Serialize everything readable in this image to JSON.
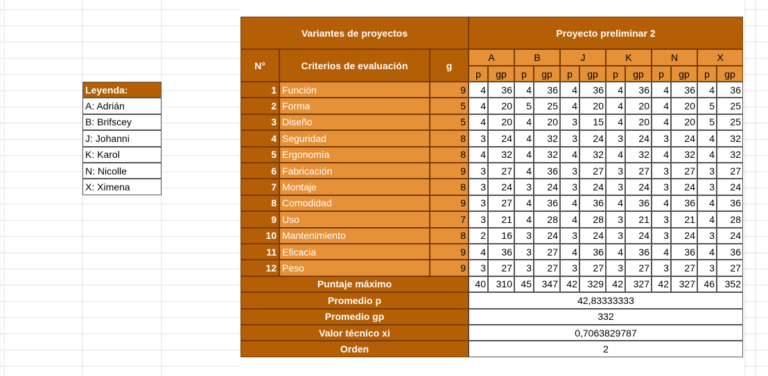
{
  "legend": {
    "title": "Leyenda:",
    "items": [
      "A: Adrián",
      "B: Brifscey",
      "J: Johanni",
      "K: Karol",
      "N: Nicolle",
      "X: Ximena"
    ]
  },
  "table": {
    "title_left": "Variantes de proyectos",
    "title_right": "Proyecto preliminar 2",
    "col_no": "N°",
    "col_criteria": "Criterios de evaluación",
    "col_g": "g",
    "groups": [
      "A",
      "B",
      "J",
      "K",
      "N",
      "X"
    ],
    "sub_p": "p",
    "sub_gp": "gp",
    "rows": [
      {
        "n": "1",
        "criterio": "Función",
        "g": "9",
        "vals": [
          "4",
          "36",
          "4",
          "36",
          "4",
          "36",
          "4",
          "36",
          "4",
          "36",
          "4",
          "36"
        ]
      },
      {
        "n": "2",
        "criterio": "Forma",
        "g": "5",
        "vals": [
          "4",
          "20",
          "5",
          "25",
          "4",
          "20",
          "4",
          "20",
          "4",
          "20",
          "5",
          "25"
        ]
      },
      {
        "n": "3",
        "criterio": "Diseño",
        "g": "5",
        "vals": [
          "4",
          "20",
          "4",
          "20",
          "3",
          "15",
          "4",
          "20",
          "4",
          "20",
          "5",
          "25"
        ]
      },
      {
        "n": "4",
        "criterio": "Seguridad",
        "g": "8",
        "vals": [
          "3",
          "24",
          "4",
          "32",
          "3",
          "24",
          "3",
          "24",
          "3",
          "24",
          "4",
          "32"
        ]
      },
      {
        "n": "5",
        "criterio": "Ergonomía",
        "g": "8",
        "vals": [
          "4",
          "32",
          "4",
          "32",
          "4",
          "32",
          "4",
          "32",
          "4",
          "32",
          "4",
          "32"
        ]
      },
      {
        "n": "6",
        "criterio": "Fabricación",
        "g": "9",
        "vals": [
          "3",
          "27",
          "4",
          "36",
          "3",
          "27",
          "3",
          "27",
          "3",
          "27",
          "3",
          "27"
        ]
      },
      {
        "n": "7",
        "criterio": "Montaje",
        "g": "8",
        "vals": [
          "3",
          "24",
          "3",
          "24",
          "3",
          "24",
          "3",
          "24",
          "3",
          "24",
          "3",
          "24"
        ]
      },
      {
        "n": "8",
        "criterio": "Comodidad",
        "g": "9",
        "vals": [
          "3",
          "27",
          "4",
          "36",
          "4",
          "36",
          "4",
          "36",
          "4",
          "36",
          "4",
          "36"
        ]
      },
      {
        "n": "9",
        "criterio": "Uso",
        "g": "7",
        "vals": [
          "3",
          "21",
          "4",
          "28",
          "4",
          "28",
          "3",
          "21",
          "3",
          "21",
          "4",
          "28"
        ]
      },
      {
        "n": "10",
        "criterio": "Mantenimiento",
        "g": "8",
        "vals": [
          "2",
          "16",
          "3",
          "24",
          "3",
          "24",
          "3",
          "24",
          "3",
          "24",
          "3",
          "24"
        ]
      },
      {
        "n": "11",
        "criterio": "Eficacia",
        "g": "9",
        "vals": [
          "4",
          "36",
          "3",
          "27",
          "4",
          "36",
          "4",
          "36",
          "4",
          "36",
          "4",
          "36"
        ]
      },
      {
        "n": "12",
        "criterio": "Peso",
        "g": "9",
        "vals": [
          "3",
          "27",
          "3",
          "27",
          "3",
          "27",
          "3",
          "27",
          "3",
          "27",
          "3",
          "27"
        ]
      }
    ],
    "puntaje_label": "Puntaje máximo",
    "puntaje_vals": [
      "40",
      "310",
      "45",
      "347",
      "42",
      "329",
      "42",
      "327",
      "42",
      "327",
      "46",
      "352"
    ],
    "summary": [
      {
        "label": "Promedio p",
        "value": "42,83333333"
      },
      {
        "label": "Promedio gp",
        "value": "332"
      },
      {
        "label": "Valor técnico xi",
        "value": "0,7063829787"
      },
      {
        "label": "Orden",
        "value": "2"
      }
    ]
  },
  "colors": {
    "header": "#b45f06",
    "subheader": "#e69138",
    "gridline": "#e2e2e2"
  }
}
